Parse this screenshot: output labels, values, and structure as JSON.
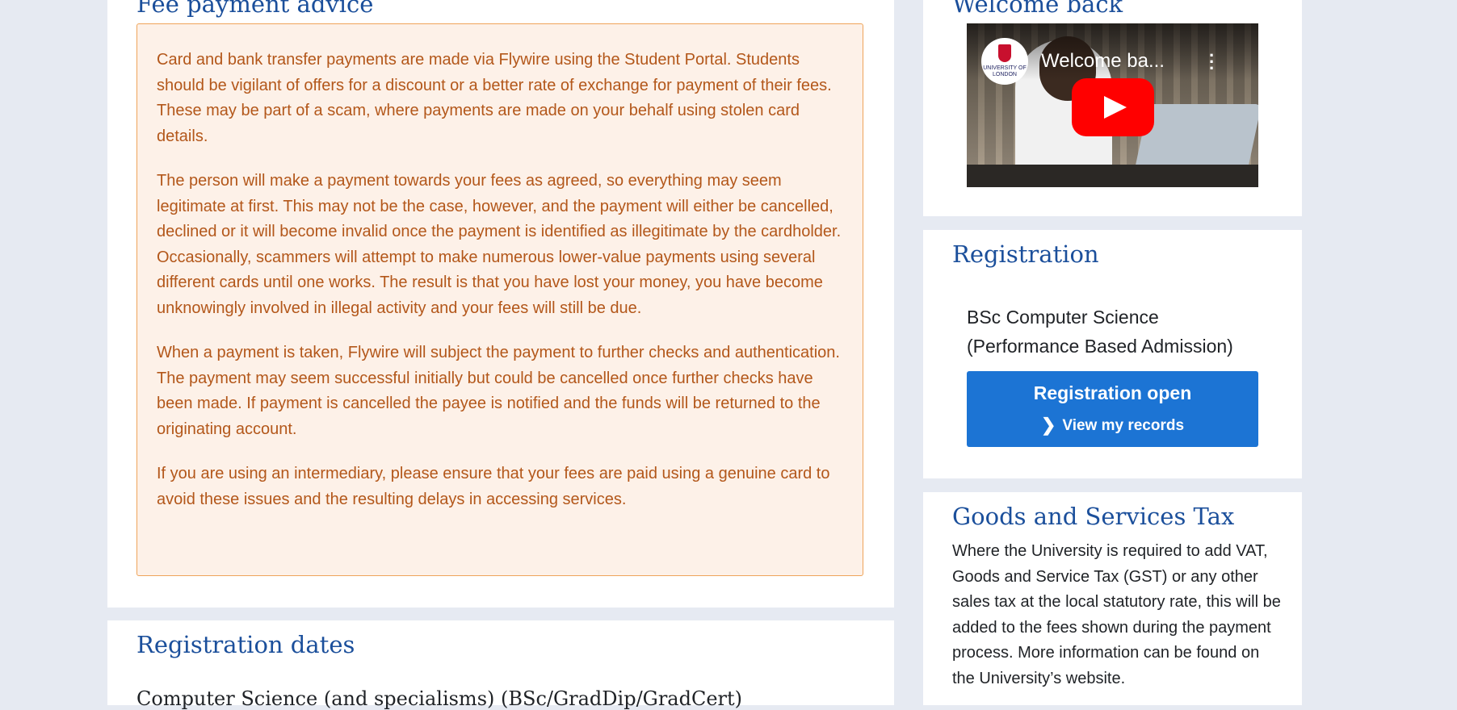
{
  "fee_advice": {
    "title": "Fee payment advice",
    "paragraphs": [
      "Card and bank transfer payments are made via Flywire using the Student Portal. Students should be vigilant of offers for a discount or a better rate of exchange for payment of their fees. These may be part of a scam, where payments are made on your behalf using stolen card details.",
      "The person will make a payment towards your fees as agreed, so everything may seem legitimate at first. This may not be the case, however, and the payment will either be cancelled, declined or it will become invalid once the payment is identified as illegitimate by the cardholder. Occasionally, scammers will attempt to make numerous lower-value payments using several different cards until one works. The result is that you have lost your money, you have become unknowingly involved in illegal activity and your fees will still be due.",
      "When a payment is taken, Flywire will subject the payment to further checks and authentication. The payment may seem successful initially but could be cancelled once further checks have been made. If payment is cancelled the payee is notified and the funds will be returned to the originating account.",
      "If you are using an intermediary, please ensure that your fees are paid using a genuine card to avoid these issues and the resulting delays in accessing services."
    ]
  },
  "registration_dates": {
    "title": "Registration dates",
    "subheading": "Computer Science (and specialisms) (BSc/GradDip/GradCert)"
  },
  "welcome": {
    "title": "Welcome back",
    "video": {
      "title": "Welcome ba...",
      "channel_logo_text": "UNIVERSITY OF LONDON",
      "icons": [
        "youtube-play-icon",
        "more-vertical-icon"
      ]
    }
  },
  "registration": {
    "title": "Registration",
    "programme": "BSc Computer Science (Performance Based Admission)",
    "button_title": "Registration open",
    "button_link": "View my records",
    "button_color": "#1c74d4"
  },
  "gst": {
    "title": "Goods and Services Tax",
    "text": "Where the University is required to add VAT, Goods and Service Tax (GST) or any other sales tax at the local statutory rate, this will be added to the fees shown during the payment process. More information can be found on the University’s website."
  },
  "colors": {
    "heading": "#1b4f9b",
    "advice_bg": "#fdf1e8",
    "advice_border": "#efa45a",
    "advice_text": "#b3571a",
    "page_bg": "#e6eaf2"
  }
}
